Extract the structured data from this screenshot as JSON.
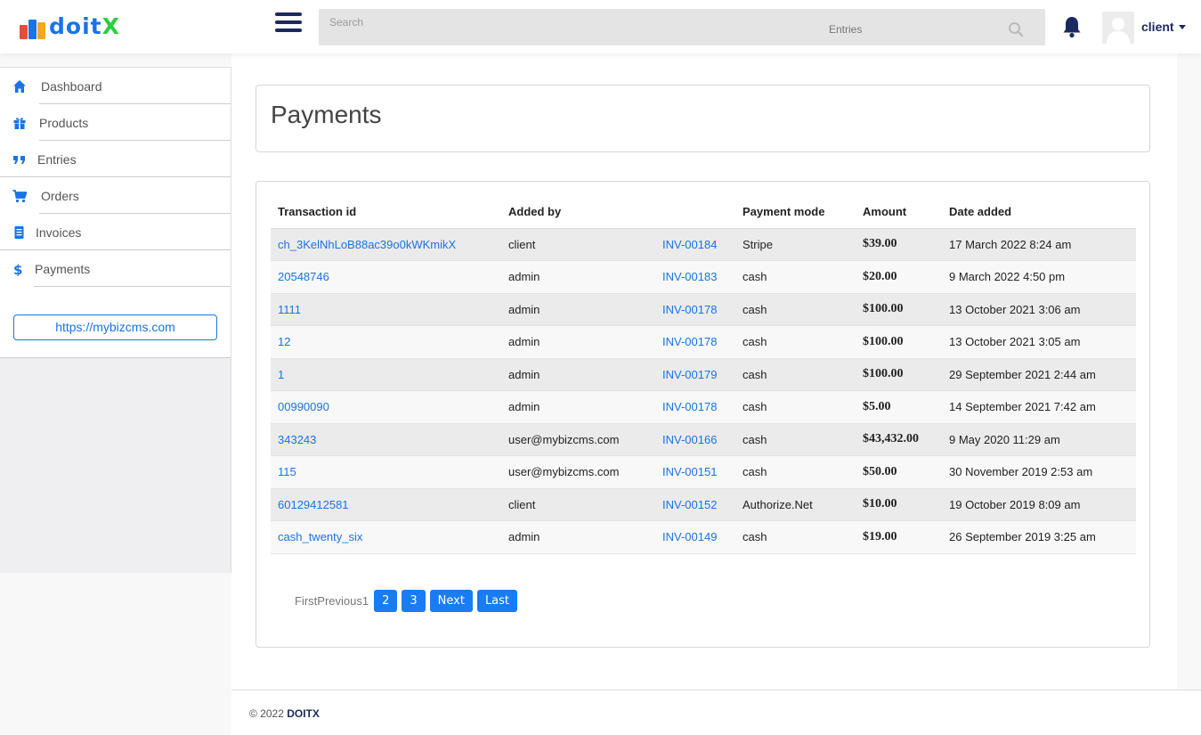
{
  "brand": {
    "logo_text": "doitX",
    "colors": [
      "#e74c3c",
      "#1a73e8",
      "#f5a623",
      "#2ecc40"
    ]
  },
  "header": {
    "search_placeholder": "Search",
    "search_scope": "Entries",
    "user_name": "client"
  },
  "sidebar": {
    "items": [
      {
        "label": "Dashboard",
        "icon": "home-icon"
      },
      {
        "label": "Products",
        "icon": "gift-icon"
      },
      {
        "label": "Entries",
        "icon": "quote-icon"
      },
      {
        "label": "Orders",
        "icon": "cart-icon"
      },
      {
        "label": "Invoices",
        "icon": "document-icon"
      },
      {
        "label": "Payments",
        "icon": "dollar-icon"
      }
    ],
    "site_link": "https://mybizcms.com"
  },
  "page": {
    "title": "Payments"
  },
  "table": {
    "headers": [
      "Transaction id",
      "Added by",
      "",
      "Payment mode",
      "Amount",
      "Date added"
    ],
    "rows": [
      [
        "ch_3KelNhLoB88ac39o0kWKmikX",
        "client",
        "INV-00184",
        "Stripe",
        "$39.00",
        "17 March 2022 8:24 am"
      ],
      [
        "20548746",
        "admin",
        "INV-00183",
        "cash",
        "$20.00",
        "9 March 2022 4:50 pm"
      ],
      [
        "1111",
        "admin",
        "INV-00178",
        "cash",
        "$100.00",
        "13 October 2021 3:06 am"
      ],
      [
        "12",
        "admin",
        "INV-00178",
        "cash",
        "$100.00",
        "13 October 2021 3:05 am"
      ],
      [
        "1",
        "admin",
        "INV-00179",
        "cash",
        "$100.00",
        "29 September 2021 2:44 am"
      ],
      [
        "00990090",
        "admin",
        "INV-00178",
        "cash",
        "$5.00",
        "14 September 2021 7:42 am"
      ],
      [
        "343243",
        "user@mybizcms.com",
        "INV-00166",
        "cash",
        "$43,432.00",
        "9 May 2020 11:29 am"
      ],
      [
        "115",
        "user@mybizcms.com",
        "INV-00151",
        "cash",
        "$50.00",
        "30 November 2019 2:53 am"
      ],
      [
        "60129412581",
        "client",
        "INV-00152",
        "Authorize.Net",
        "$10.00",
        "19 October 2019 8:09 am"
      ],
      [
        "cash_twenty_six",
        "admin",
        "INV-00149",
        "cash",
        "$19.00",
        "26 September 2019 3:25 am"
      ]
    ]
  },
  "pager": {
    "prefix": "FirstPrevious1",
    "pages": [
      "2",
      "3"
    ],
    "next": "Next",
    "last": "Last"
  },
  "footer": {
    "copyright": "© 2022",
    "brand": "DOITX"
  },
  "theme": {
    "accent": "#1a73e8",
    "navy": "#1b2a5e"
  }
}
